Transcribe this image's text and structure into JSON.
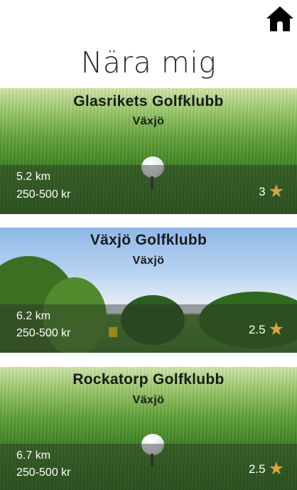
{
  "header": {
    "title": "Nära mig",
    "home_icon": "home-icon"
  },
  "courses": [
    {
      "name": "Glasrikets Golfklubb",
      "city": "Växjö",
      "distance": "5.2 km",
      "price": "250-500 kr",
      "rating": "3",
      "image": "golf-ball-on-grass"
    },
    {
      "name": "Växjö Golfklubb",
      "city": "Växjö",
      "distance": "6.2 km",
      "price": "250-500 kr",
      "rating": "2.5",
      "image": "golf-course-with-flag"
    },
    {
      "name": "Rockatorp Golfklubb",
      "city": "Växjö",
      "distance": "6.7 km",
      "price": "250-500 kr",
      "rating": "2.5",
      "image": "golf-ball-on-grass"
    }
  ],
  "colors": {
    "star": "#d8a53e",
    "title_text": "#1a1a1a",
    "overlay_text": "#ffffff"
  }
}
